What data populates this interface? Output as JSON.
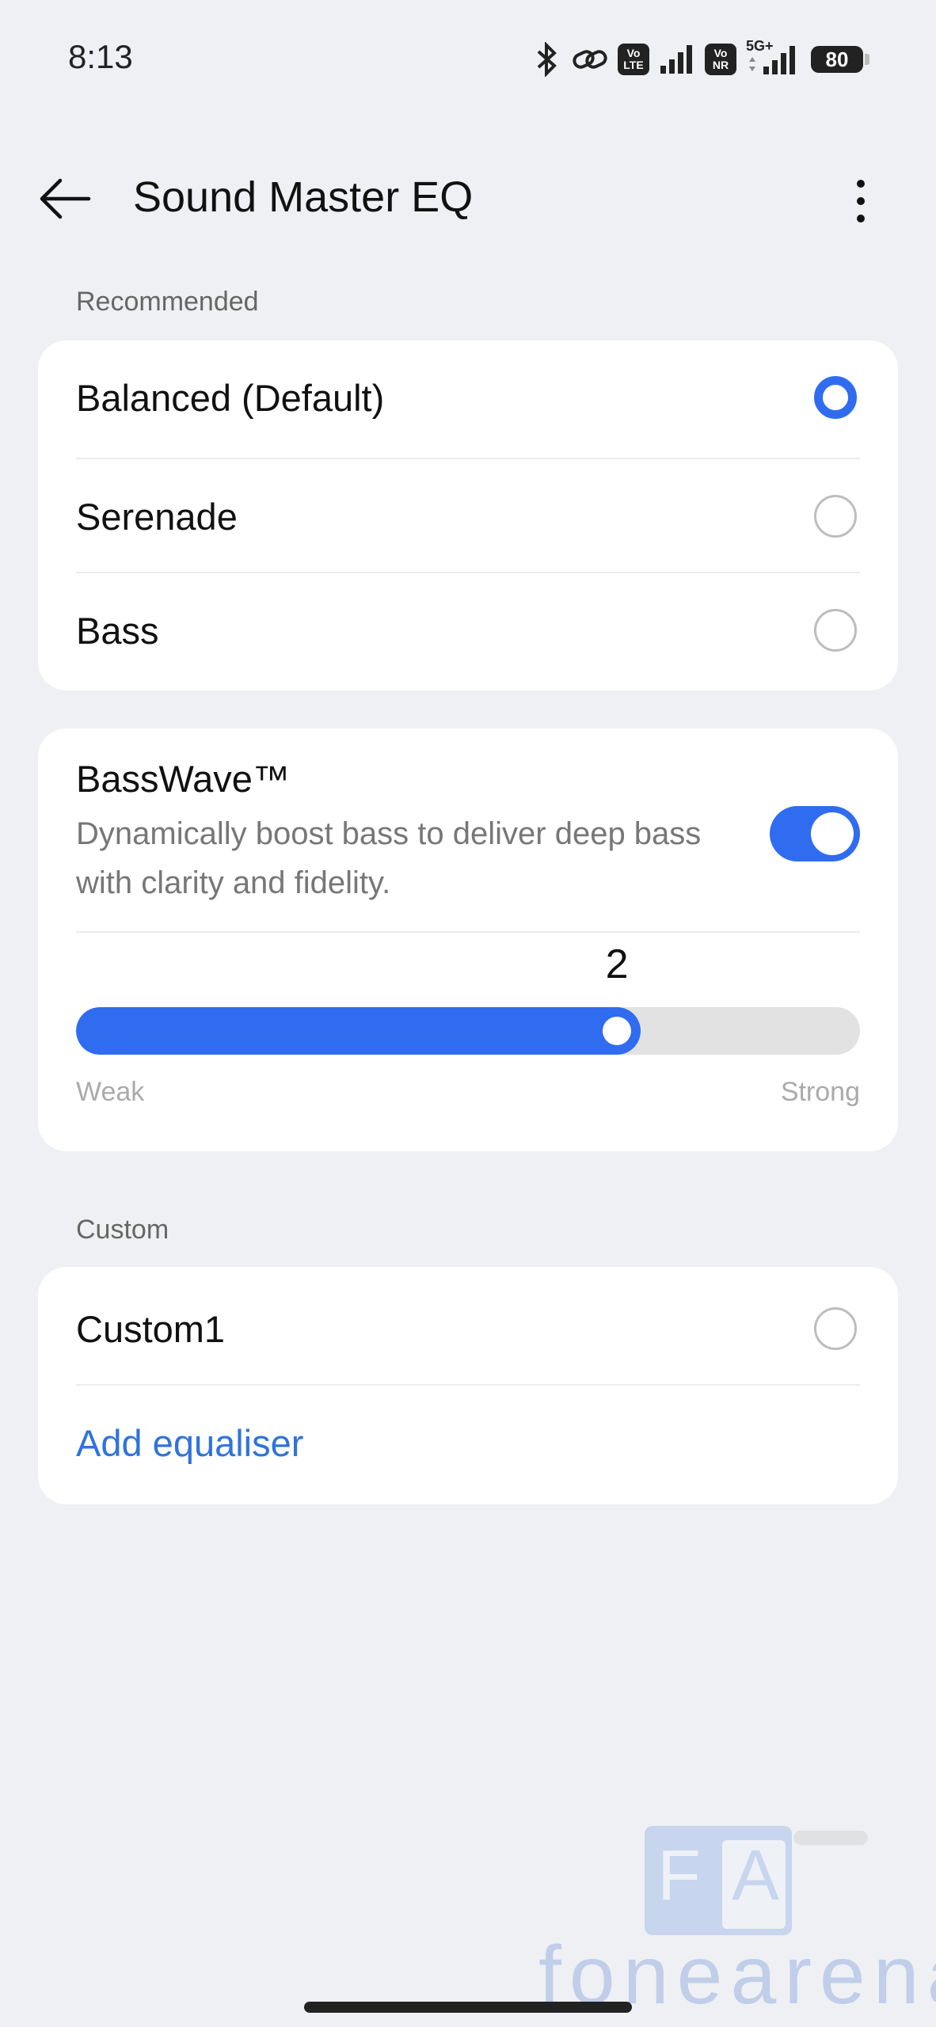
{
  "status_bar": {
    "time": "8:13",
    "battery": "80",
    "icons": [
      "bluetooth-icon",
      "link-icon",
      "volte-icon",
      "signal-icon",
      "vonr-icon",
      "5g-signal-icon",
      "battery-icon"
    ],
    "volte_top": "Vo",
    "volte_bottom": "LTE",
    "vonr_top": "Vo",
    "vonr_bottom": "NR",
    "network": "5G+"
  },
  "app_bar": {
    "title": "Sound Master EQ"
  },
  "recommended": {
    "header": "Recommended",
    "items": [
      {
        "label": "Balanced (Default)",
        "selected": true
      },
      {
        "label": "Serenade",
        "selected": false
      },
      {
        "label": "Bass",
        "selected": false
      }
    ]
  },
  "basswave": {
    "title": "BassWave™",
    "description": "Dynamically boost bass to deliver deep bass with clarity and fidelity.",
    "enabled": true,
    "level": "2",
    "level_fraction": 0.69,
    "min_label": "Weak",
    "max_label": "Strong"
  },
  "custom": {
    "header": "Custom",
    "items": [
      {
        "label": "Custom1",
        "selected": false
      }
    ],
    "add_label": "Add equaliser"
  },
  "watermark": {
    "text": "fonearena",
    "logo_letters": "FA"
  },
  "colors": {
    "accent": "#2f6cf0",
    "link": "#2f73dd",
    "background": "#eef0f3",
    "card": "#ffffff"
  }
}
